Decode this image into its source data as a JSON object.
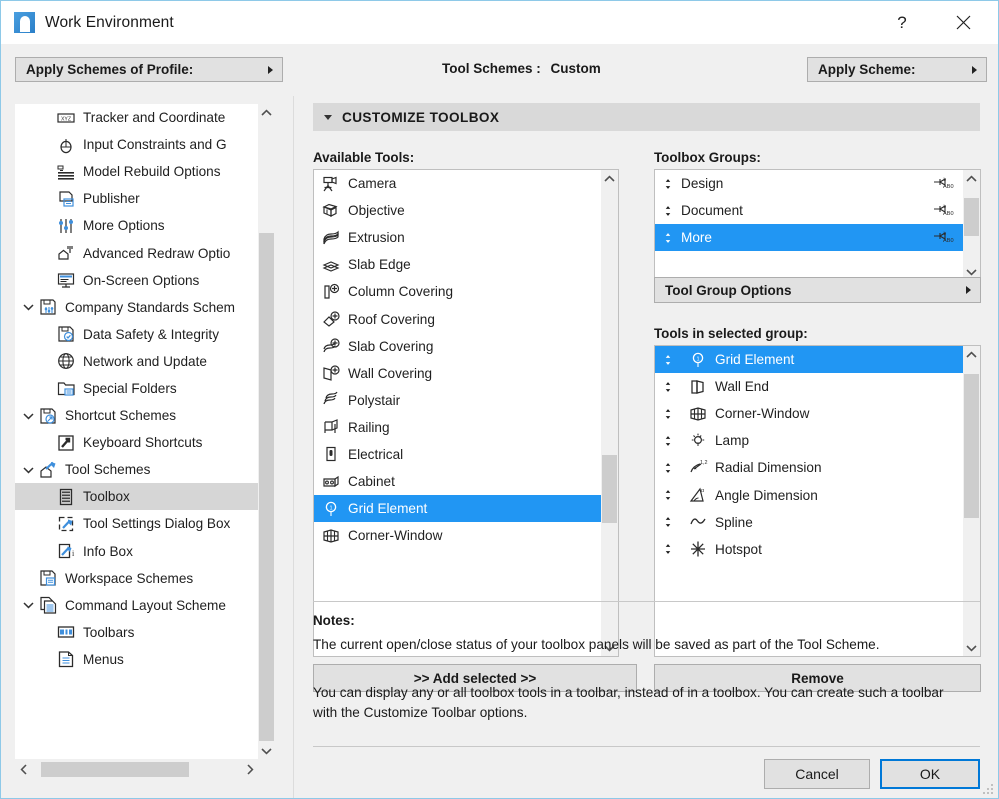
{
  "window": {
    "title": "Work Environment",
    "icon": "app-logo-icon",
    "help_label": "?",
    "close_label": "✕"
  },
  "topbar": {
    "apply_profile_label": "Apply Schemes of Profile:",
    "scheme_label": "Tool Schemes :",
    "scheme_value": "Custom",
    "apply_scheme_label": "Apply Scheme:"
  },
  "sidebar": {
    "items": [
      {
        "label": "Tracker and Coordinate",
        "indent": 1,
        "twist": "none",
        "icon": "tracker-coordinate-icon",
        "selected": false
      },
      {
        "label": "Input Constraints and G",
        "indent": 1,
        "twist": "none",
        "icon": "mouse-icon",
        "selected": false
      },
      {
        "label": "Model Rebuild Options",
        "indent": 1,
        "twist": "none",
        "icon": "model-rebuild-icon",
        "selected": false
      },
      {
        "label": "Publisher",
        "indent": 1,
        "twist": "none",
        "icon": "publisher-icon",
        "selected": false
      },
      {
        "label": "More Options",
        "indent": 1,
        "twist": "none",
        "icon": "sliders-icon",
        "selected": false
      },
      {
        "label": "Advanced Redraw Optio",
        "indent": 1,
        "twist": "none",
        "icon": "advanced-redraw-icon",
        "selected": false
      },
      {
        "label": "On-Screen Options",
        "indent": 1,
        "twist": "none",
        "icon": "monitor-icon",
        "selected": false
      },
      {
        "label": "Company Standards Schem",
        "indent": 0,
        "twist": "expanded",
        "icon": "company-standards-icon",
        "selected": false
      },
      {
        "label": "Data Safety & Integrity",
        "indent": 1,
        "twist": "none",
        "icon": "data-safety-icon",
        "selected": false
      },
      {
        "label": "Network and Update",
        "indent": 1,
        "twist": "none",
        "icon": "globe-icon",
        "selected": false
      },
      {
        "label": "Special Folders",
        "indent": 1,
        "twist": "none",
        "icon": "folder-icon",
        "selected": false
      },
      {
        "label": "Shortcut Schemes",
        "indent": 0,
        "twist": "expanded",
        "icon": "shortcut-schemes-icon",
        "selected": false
      },
      {
        "label": "Keyboard Shortcuts",
        "indent": 1,
        "twist": "none",
        "icon": "keyboard-shortcuts-icon",
        "selected": false
      },
      {
        "label": "Tool Schemes",
        "indent": 0,
        "twist": "expanded",
        "icon": "tool-schemes-icon",
        "selected": false
      },
      {
        "label": "Toolbox",
        "indent": 1,
        "twist": "none",
        "icon": "toolbox-icon",
        "selected": true
      },
      {
        "label": "Tool Settings Dialog Box",
        "indent": 1,
        "twist": "none",
        "icon": "tool-settings-icon",
        "selected": false
      },
      {
        "label": "Info Box",
        "indent": 1,
        "twist": "none",
        "icon": "info-box-icon",
        "selected": false
      },
      {
        "label": "Workspace Schemes",
        "indent": 0,
        "twist": "none",
        "icon": "workspace-schemes-icon",
        "selected": false
      },
      {
        "label": "Command Layout Scheme",
        "indent": 0,
        "twist": "expanded",
        "icon": "command-layout-icon",
        "selected": false
      },
      {
        "label": "Toolbars",
        "indent": 1,
        "twist": "none",
        "icon": "toolbars-icon",
        "selected": false
      },
      {
        "label": "Menus",
        "indent": 1,
        "twist": "none",
        "icon": "menus-icon",
        "selected": false
      }
    ]
  },
  "panel": {
    "title": "CUSTOMIZE TOOLBOX",
    "available_label": "Available Tools:",
    "groups_label": "Toolbox Groups:",
    "selgroup_label": "Tools in selected group:",
    "tool_group_options_label": "Tool Group Options",
    "add_selected_label": ">> Add selected >>",
    "remove_label": "Remove",
    "notes_title": "Notes:",
    "note_1": "The current open/close status of your toolbox panels will be saved as part of the Tool Scheme.",
    "note_2": "You can display any or all toolbox tools in a toolbar, instead of in a toolbox. You can create such a toolbar with the Customize Toolbar options.",
    "cancel_label": "Cancel",
    "ok_label": "OK"
  },
  "available_tools": [
    {
      "label": "Camera",
      "icon": "camera-icon",
      "selected": false
    },
    {
      "label": "Objective",
      "icon": "objective-icon",
      "selected": false
    },
    {
      "label": "Extrusion",
      "icon": "extrusion-icon",
      "selected": false
    },
    {
      "label": "Slab Edge",
      "icon": "slab-edge-icon",
      "selected": false
    },
    {
      "label": "Column Covering",
      "icon": "column-covering-icon",
      "selected": false
    },
    {
      "label": "Roof Covering",
      "icon": "roof-covering-icon",
      "selected": false
    },
    {
      "label": "Slab Covering",
      "icon": "slab-covering-icon",
      "selected": false
    },
    {
      "label": "Wall Covering",
      "icon": "wall-covering-icon",
      "selected": false
    },
    {
      "label": "Polystair",
      "icon": "polystair-icon",
      "selected": false
    },
    {
      "label": "Railing",
      "icon": "railing-icon",
      "selected": false
    },
    {
      "label": "Electrical",
      "icon": "electrical-icon",
      "selected": false
    },
    {
      "label": "Cabinet",
      "icon": "cabinet-icon",
      "selected": false
    },
    {
      "label": "Grid Element",
      "icon": "grid-element-icon",
      "selected": true
    },
    {
      "label": "Corner-Window",
      "icon": "corner-window-icon",
      "selected": false
    }
  ],
  "toolbox_groups": [
    {
      "label": "Design",
      "selected": false,
      "tail_icon": "pin-abc-icon"
    },
    {
      "label": "Document",
      "selected": false,
      "tail_icon": "pin-abc-icon"
    },
    {
      "label": "More",
      "selected": true,
      "tail_icon": "pin-abc-icon"
    }
  ],
  "tools_in_group": [
    {
      "label": "Grid Element",
      "icon": "grid-element-icon",
      "selected": true
    },
    {
      "label": "Wall End",
      "icon": "wall-end-icon",
      "selected": false
    },
    {
      "label": "Corner-Window",
      "icon": "corner-window-icon",
      "selected": false
    },
    {
      "label": "Lamp",
      "icon": "lamp-icon",
      "selected": false
    },
    {
      "label": "Radial Dimension",
      "icon": "radial-dimension-icon",
      "selected": false
    },
    {
      "label": "Angle Dimension",
      "icon": "angle-dimension-icon",
      "selected": false
    },
    {
      "label": "Spline",
      "icon": "spline-icon",
      "selected": false
    },
    {
      "label": "Hotspot",
      "icon": "hotspot-icon",
      "selected": false
    }
  ],
  "colors": {
    "selection_blue": "#2196f3",
    "tree_selection_gray": "#d6d6d6",
    "dialog_bg": "#f0f0f0",
    "accent_border": "#0078d7",
    "panel_header": "#d9d9d9"
  }
}
